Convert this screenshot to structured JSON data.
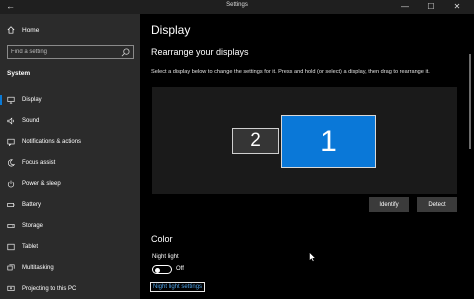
{
  "window": {
    "title": "Settings",
    "back_glyph": "←",
    "minimize_glyph": "—",
    "maximize_glyph": "☐",
    "close_glyph": "✕"
  },
  "sidebar": {
    "home_label": "Home",
    "search_placeholder": "Find a setting",
    "section_label": "System",
    "items": [
      {
        "label": "Display",
        "icon": "display-icon",
        "active": true
      },
      {
        "label": "Sound",
        "icon": "sound-icon"
      },
      {
        "label": "Notifications & actions",
        "icon": "notifications-icon"
      },
      {
        "label": "Focus assist",
        "icon": "focus-assist-icon"
      },
      {
        "label": "Power & sleep",
        "icon": "power-icon"
      },
      {
        "label": "Battery",
        "icon": "battery-icon"
      },
      {
        "label": "Storage",
        "icon": "storage-icon"
      },
      {
        "label": "Tablet",
        "icon": "tablet-icon"
      },
      {
        "label": "Multitasking",
        "icon": "multitasking-icon"
      },
      {
        "label": "Projecting to this PC",
        "icon": "projecting-icon"
      }
    ]
  },
  "main": {
    "title": "Display",
    "arrange_title": "Rearrange your displays",
    "arrange_desc": "Select a display below to change the settings for it. Press and hold (or select) a display, then drag to rearrange it.",
    "monitors": [
      {
        "number": "2",
        "selected": false
      },
      {
        "number": "1",
        "selected": true
      }
    ],
    "identify_label": "Identify",
    "detect_label": "Detect",
    "color_title": "Color",
    "night_light_label": "Night light",
    "night_light_state": "Off",
    "night_light_link": "Night light settings"
  },
  "colors": {
    "accent": "#0a78d8",
    "sidebar_bg": "#2b2b2b",
    "main_bg": "#000000",
    "link": "#4fa3e8"
  }
}
